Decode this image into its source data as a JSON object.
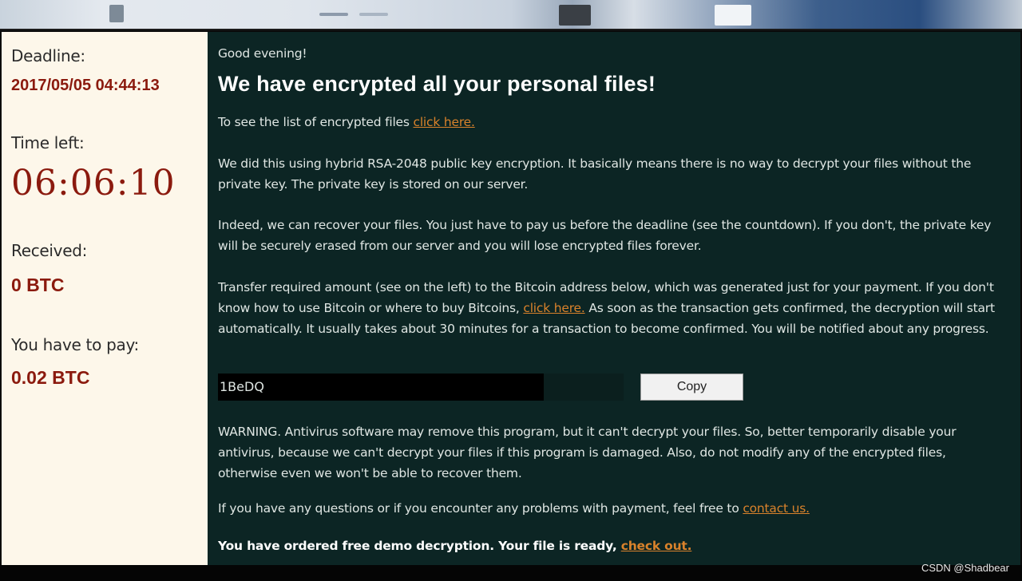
{
  "left_panel": {
    "deadline_label": "Deadline:",
    "deadline_value": "2017/05/05 04:44:13",
    "time_left_label": "Time left:",
    "time_left_value": "06:06:10",
    "received_label": "Received:",
    "received_value": "0 BTC",
    "pay_label": "You have to pay:",
    "pay_value": "0.02 BTC"
  },
  "message": {
    "greeting": "Good evening!",
    "headline": "We have encrypted all your personal files!",
    "list_text": "To see the list of encrypted files ",
    "list_link": "click here.",
    "p1": "We did this using hybrid RSA-2048 public key encryption. It basically means there is no way to decrypt your files without the private key. The private key is stored on our server.",
    "p2": "Indeed, we can recover your files. You just have to pay us before the deadline (see the countdown). If you don't, the private key will be securely erased from our server and you will lose encrypted files forever.",
    "p3_a": "Transfer required amount (see on the left) to the Bitcoin address below, which was generated just for your payment. If you don't know how to use Bitcoin or where to buy Bitcoins, ",
    "p3_link": "click here.",
    "p3_b": " As soon as the transaction gets confirmed, the decryption will start automatically. It usually takes about 30 minutes for a transaction to become confirmed. You will be notified about any progress.",
    "btc_address": "1BeDQ",
    "copy_label": "Copy",
    "warning": "WARNING. Antivirus software may remove this program, but it can't decrypt your files. So, better temporarily disable your antivirus, because we can't decrypt your files if this program is damaged. Also, do not modify any of the encrypted files, otherwise even we won't be able to recover them.",
    "contact_text": "If you have any questions or if you encounter any problems with payment, feel free to ",
    "contact_link": "contact us.",
    "demo_text": "You have ordered free demo decryption. Your file is ready, ",
    "demo_link": "check out."
  },
  "watermark": "CSDN @Shadbear",
  "colors": {
    "left_bg": "#fdf7ea",
    "right_bg": "#0c2524",
    "accent_red": "#8b1a0e",
    "link_orange": "#d9822b"
  }
}
